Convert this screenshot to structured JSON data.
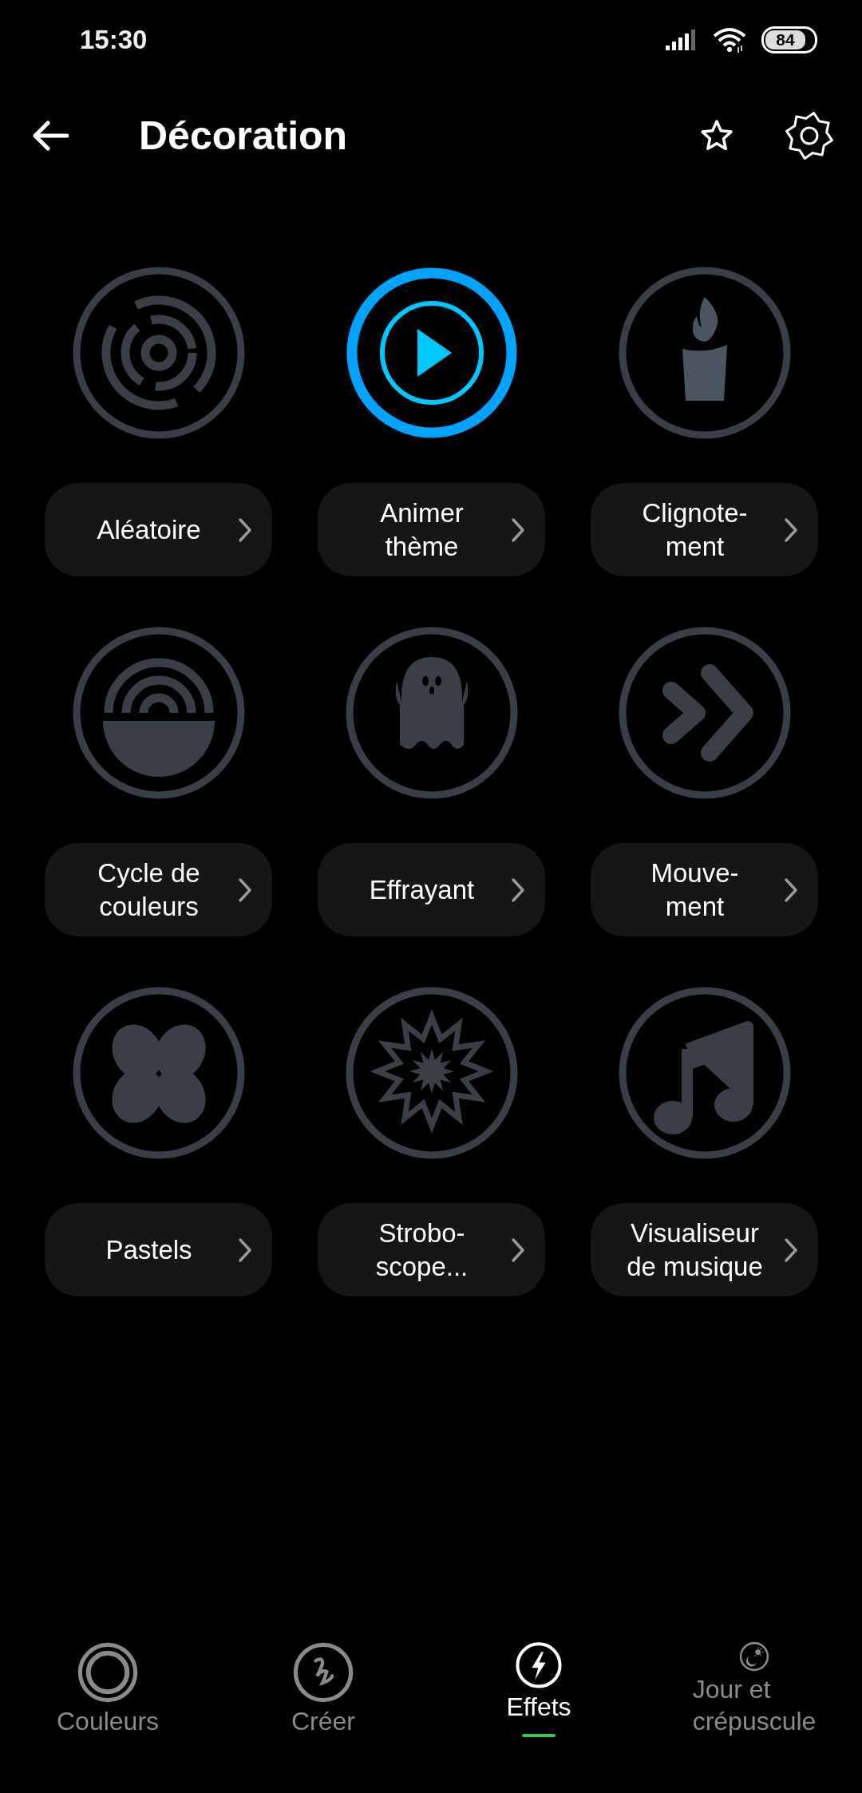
{
  "status_bar": {
    "time": "15:30",
    "battery": "84"
  },
  "header": {
    "title": "Décoration"
  },
  "effects": [
    {
      "kind": "random",
      "label": "Aléatoire",
      "selected": false
    },
    {
      "kind": "play",
      "label": "Animer\nthème",
      "selected": true
    },
    {
      "kind": "candle",
      "label": "Clignote-\nment",
      "selected": false
    },
    {
      "kind": "cycle",
      "label": "Cycle de\ncouleurs",
      "selected": false
    },
    {
      "kind": "ghost",
      "label": "Effrayant",
      "selected": false
    },
    {
      "kind": "forward",
      "label": "Mouve-\nment",
      "selected": false
    },
    {
      "kind": "petals",
      "label": "Pastels",
      "selected": false
    },
    {
      "kind": "strobe",
      "label": "Strobo-\nscope...",
      "selected": false
    },
    {
      "kind": "music",
      "label": "Visualiseur\nde musique",
      "selected": false
    }
  ],
  "nav": [
    {
      "kind": "rings",
      "label": "Couleurs",
      "selected": false
    },
    {
      "kind": "squiggle",
      "label": "Créer",
      "selected": false
    },
    {
      "kind": "bolt",
      "label": "Effets",
      "selected": true
    },
    {
      "kind": "daynight",
      "label": "Jour et\ncrépuscule",
      "selected": false
    }
  ]
}
